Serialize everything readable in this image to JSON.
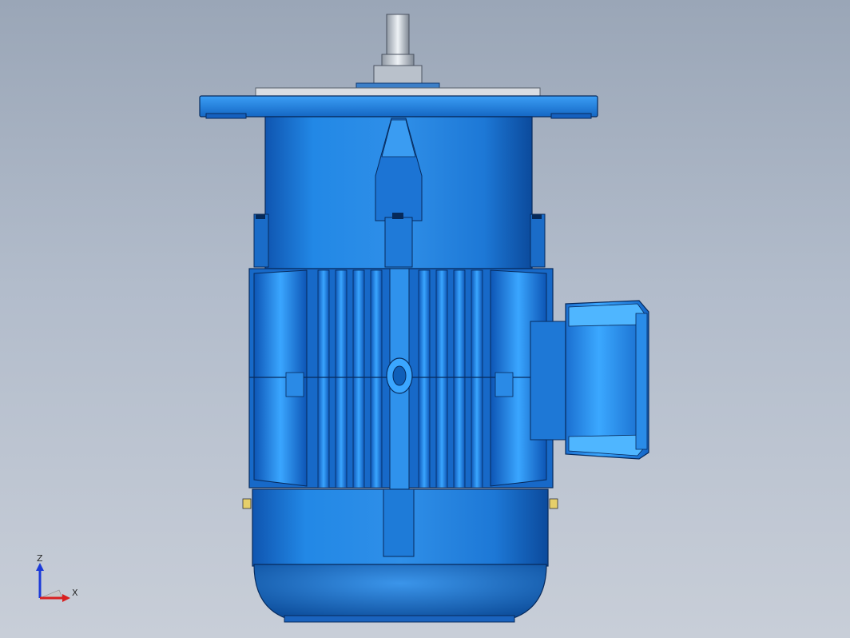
{
  "viewport": {
    "background_top": "#9aa6b7",
    "background_bottom": "#c8ced8"
  },
  "model": {
    "body_color": "#1f7fd8",
    "body_dark": "#0b3f8a",
    "body_light": "#4fb0ff",
    "shaft_color": "#c9d0d8",
    "outline_color": "#072a5c"
  },
  "triad": {
    "z_label": "Z",
    "x_label": "X",
    "z_color": "#1b3ad8",
    "x_color": "#d82020"
  }
}
